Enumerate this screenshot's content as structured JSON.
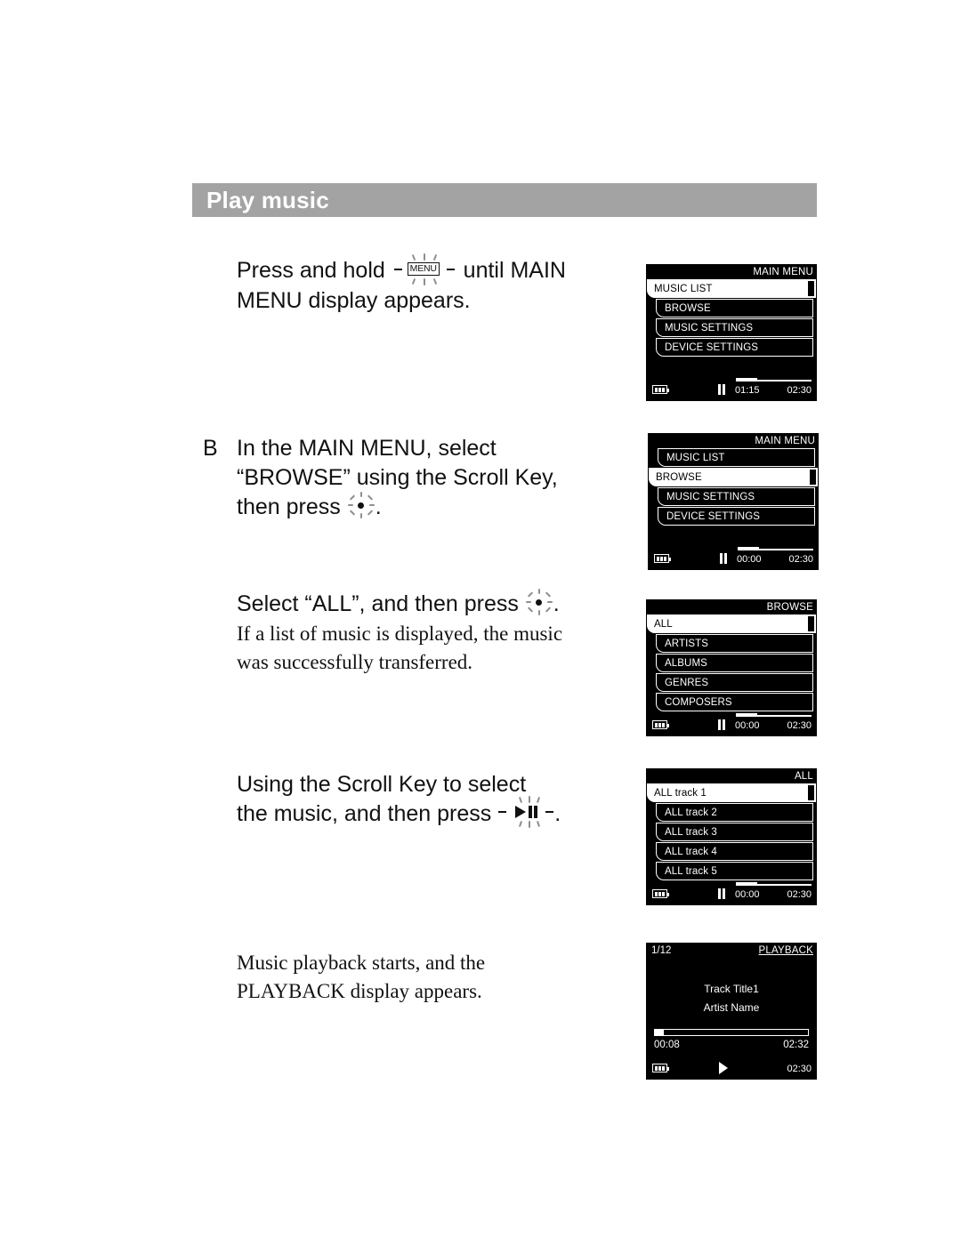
{
  "header": {
    "title": "Play music"
  },
  "steps": [
    {
      "marker": "",
      "line1_pre": "Press and hold ",
      "icon": "menu-key-icon",
      "line1_post": " until MAIN",
      "line2": "MENU display appears."
    },
    {
      "marker": "B",
      "line1": "In the MAIN MENU, select",
      "line2": "“BROWSE” using the Scroll Key,",
      "line3_pre": "then press ",
      "icon": "scroll-key-center-icon",
      "line3_post": "."
    },
    {
      "marker": "",
      "line1_pre": "Select “ALL”, and then press ",
      "icon": "scroll-key-center-icon",
      "line1_post": ".",
      "note1": "If a list of music is displayed, the music",
      "note2": "was successfully transferred."
    },
    {
      "marker": "",
      "line1": "Using the Scroll Key to select",
      "line2_pre": "the music, and then press ",
      "icon": "play-pause-key-icon",
      "line2_post": "."
    },
    {
      "marker": "",
      "note1": "Music playback starts, and the",
      "note2": "PLAYBACK display appears."
    }
  ],
  "devices": [
    {
      "title": "MAIN MENU",
      "items": [
        {
          "label": "MUSIC LIST",
          "selected": true
        },
        {
          "label": "BROWSE",
          "selected": false
        },
        {
          "label": "MUSIC SETTINGS",
          "selected": false
        },
        {
          "label": "DEVICE SETTINGS",
          "selected": false
        }
      ],
      "status": {
        "transport": "pause",
        "elapsed": "01:15",
        "total": "02:30",
        "battery": 3
      }
    },
    {
      "title": "MAIN MENU",
      "items": [
        {
          "label": "MUSIC LIST",
          "selected": false
        },
        {
          "label": "BROWSE",
          "selected": true
        },
        {
          "label": "MUSIC SETTINGS",
          "selected": false
        },
        {
          "label": "DEVICE SETTINGS",
          "selected": false
        }
      ],
      "status": {
        "transport": "pause",
        "elapsed": "00:00",
        "total": "02:30",
        "battery": 3
      }
    },
    {
      "title": "BROWSE",
      "items": [
        {
          "label": "ALL",
          "selected": true
        },
        {
          "label": "ARTISTS",
          "selected": false
        },
        {
          "label": "ALBUMS",
          "selected": false
        },
        {
          "label": "GENRES",
          "selected": false
        },
        {
          "label": "COMPOSERS",
          "selected": false
        }
      ],
      "status": {
        "transport": "pause",
        "elapsed": "00:00",
        "total": "02:30",
        "battery": 3
      }
    },
    {
      "title": "ALL",
      "items": [
        {
          "label": "ALL track 1",
          "selected": true
        },
        {
          "label": "ALL track 2",
          "selected": false
        },
        {
          "label": "ALL track 3",
          "selected": false
        },
        {
          "label": "ALL track 4",
          "selected": false
        },
        {
          "label": "ALL track 5",
          "selected": false
        }
      ],
      "status": {
        "transport": "pause",
        "elapsed": "00:00",
        "total": "02:30",
        "battery": 3
      }
    },
    {
      "title": "PLAYBACK",
      "counter": "1/12",
      "track": "Track Title1",
      "artist": "Artist Name",
      "elapsed": "00:08",
      "total": "02:32",
      "status": {
        "transport": "play",
        "total": "02:30",
        "battery": 3
      }
    }
  ],
  "colors": {
    "header_band": "#a3a3a3",
    "header_text": "#ffffff",
    "screen_bg": "#000000",
    "screen_fg": "#ffffff",
    "body_text": "#111111"
  }
}
